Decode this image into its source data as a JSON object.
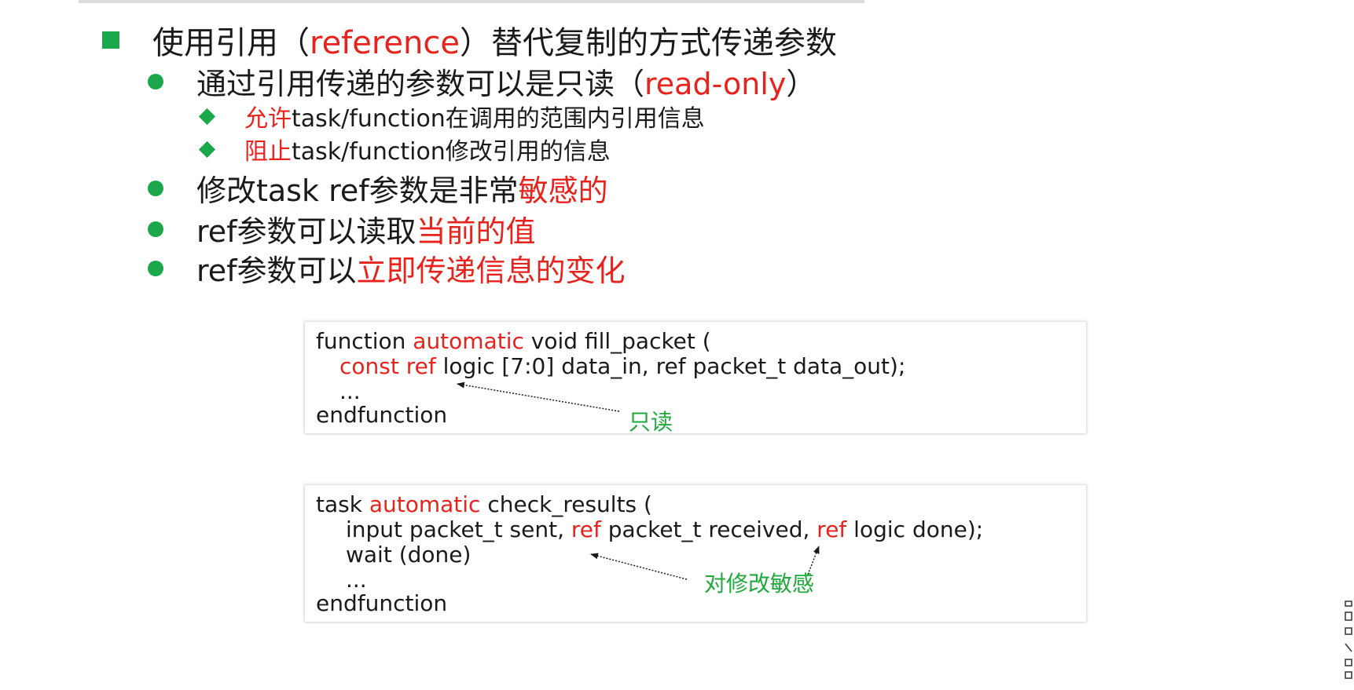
{
  "bullets": {
    "b1": {
      "pre": "使用引用（",
      "red": "reference",
      "post": "）替代复制的方式传递参数"
    },
    "b1_1": {
      "pre": "通过引用传递的参数可以是只读（",
      "red": "read-only",
      "post": "）"
    },
    "b1_1_1": {
      "red": "允许",
      "post": "task/function在调用的范围内引用信息"
    },
    "b1_1_2": {
      "red": "阻止",
      "post": "task/function修改引用的信息"
    },
    "b1_2": {
      "pre": "修改task ref参数是非常",
      "red": "敏感的"
    },
    "b1_3": {
      "pre": "ref参数可以读取",
      "red": "当前的值"
    },
    "b1_4": {
      "pre": "ref参数可以",
      "red": "立即传递信息的变化"
    }
  },
  "code1": {
    "line1": {
      "a": "function ",
      "b": "automatic",
      "c": " void fill_packet ("
    },
    "line2": {
      "a": "const ref",
      "b": " logic [7:0] data_in, ref packet_t data_out);"
    },
    "line3": "...",
    "line4": "endfunction",
    "annotation": "只读"
  },
  "code2": {
    "line1": {
      "a": "task ",
      "b": "automatic",
      "c": " check_results ("
    },
    "line2": {
      "a": "input packet_t sent, ",
      "b": "ref",
      "c": " packet_t received, ",
      "d": "ref",
      "e": " logic done);"
    },
    "line3": "wait (done)",
    "line4": "...",
    "line5": "endfunction",
    "annotation": "对修改敏感"
  },
  "colors": {
    "accent_red": "#e8221c",
    "bullet_green": "#1aa84a",
    "annotation_green": "#1faa3c"
  }
}
